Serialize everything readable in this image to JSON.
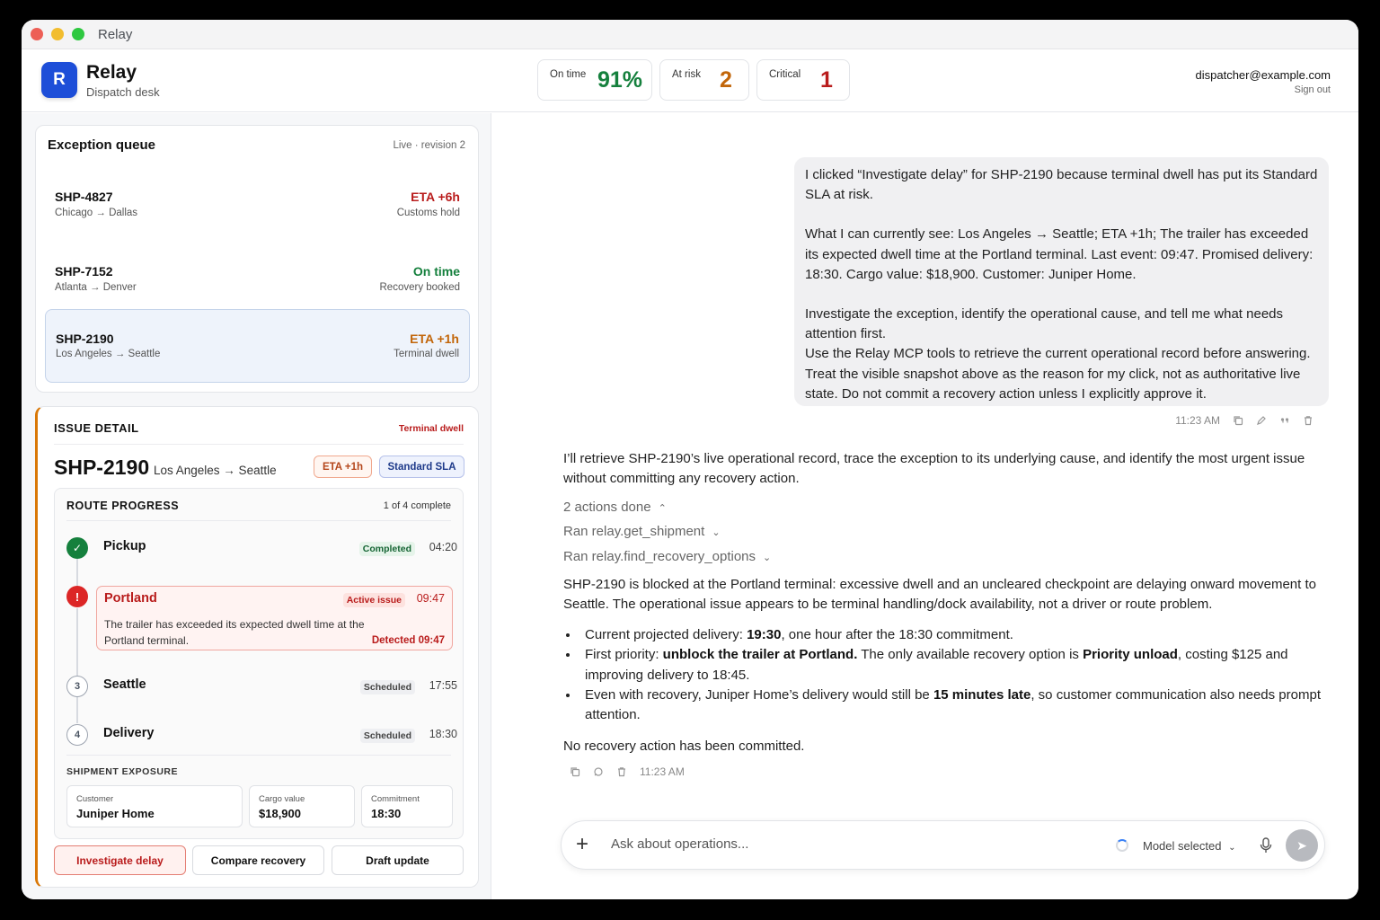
{
  "window": {
    "title": "Relay"
  },
  "header": {
    "logo_letter": "R",
    "app_name": "Relay",
    "app_sub": "Dispatch desk",
    "metrics": [
      {
        "label": "On time",
        "value": "91%",
        "color": "#15803d"
      },
      {
        "label": "At risk",
        "value": "2",
        "color": "#c2660a"
      },
      {
        "label": "Critical",
        "value": "1",
        "color": "#b91c1c"
      }
    ],
    "user_email": "dispatcher@example.com",
    "sign_out": "Sign out"
  },
  "queue": {
    "title": "Exception queue",
    "meta": "Live · revision 2",
    "items": [
      {
        "id": "SHP-4827",
        "route": "Chicago → Dallas",
        "status": "ETA +6h",
        "status_color": "#b91c1c",
        "reason": "Customs hold"
      },
      {
        "id": "SHP-7152",
        "route": "Atlanta → Denver",
        "status": "On time",
        "status_color": "#15803d",
        "reason": "Recovery booked"
      },
      {
        "id": "SHP-2190",
        "route": "Los Angeles → Seattle",
        "status": "ETA +1h",
        "status_color": "#c2660a",
        "reason": "Terminal dwell"
      }
    ]
  },
  "detail": {
    "heading": "ISSUE DETAIL",
    "tag": "Terminal dwell",
    "id": "SHP-2190",
    "route": "Los Angeles → Seattle",
    "eta_pill": "ETA +1h",
    "sla_pill": "Standard SLA",
    "route_progress": {
      "title": "ROUTE PROGRESS",
      "count": "1 of 4 complete",
      "steps": [
        {
          "marker": "✓",
          "name": "Pickup",
          "badge": "Completed",
          "time": "04:20"
        },
        {
          "marker": "!",
          "name": "Portland",
          "badge": "Active issue",
          "time": "09:47",
          "description": "The trailer has exceeded its expected dwell time at the Portland terminal.",
          "detected": "Detected 09:47"
        },
        {
          "marker": "3",
          "name": "Seattle",
          "badge": "Scheduled",
          "time": "17:55"
        },
        {
          "marker": "4",
          "name": "Delivery",
          "badge": "Scheduled",
          "time": "18:30"
        }
      ]
    },
    "exposure": {
      "title": "SHIPMENT EXPOSURE",
      "customer_label": "Customer",
      "customer": "Juniper Home",
      "cargo_label": "Cargo value",
      "cargo": "$18,900",
      "commit_label": "Commitment",
      "commit": "18:30"
    },
    "actions": [
      "Investigate delay",
      "Compare recovery",
      "Draft update"
    ]
  },
  "chat": {
    "user_message": {
      "p1": "I clicked “Investigate delay” for SHP-2190 because terminal dwell has put its Standard SLA at risk.",
      "p2": "What I can currently see: Los Angeles → Seattle; ETA +1h; The trailer has exceeded its expected dwell time at the Portland terminal. Last event: 09:47. Promised delivery: 18:30. Cargo value: $18,900. Customer: Juniper Home.",
      "p3": "Investigate the exception, identify the operational cause, and tell me what needs attention first.",
      "p4": "Use the Relay MCP tools to retrieve the current operational record before answering. Treat the visible snapshot above as the reason for my click, not as authoritative live state. Do not commit a recovery action unless I explicitly approve it.",
      "time": "11:23 AM"
    },
    "assistant": {
      "intro": "I’ll retrieve SHP-2190’s live operational record, trace the exception to its underlying cause, and identify the most urgent issue without committing any recovery action.",
      "actions_done": "2 actions done",
      "tool1": "Ran relay.get_shipment",
      "tool2": "Ran relay.find_recovery_options",
      "summary": "SHP-2190 is blocked at the Portland terminal: excessive dwell and an uncleared checkpoint are delaying onward movement to Seattle. The operational issue appears to be terminal handling/dock availability, not a driver or route problem.",
      "b1a": "Current projected delivery: ",
      "b1b": "19:30",
      "b1c": ", one hour after the 18:30 commitment.",
      "b2a": "First priority: ",
      "b2b": "unblock the trailer at Portland.",
      "b2c": " The only available recovery option is ",
      "b2d": "Priority unload",
      "b2e": ", costing $125 and improving delivery to 18:45.",
      "b3a": "Even with recovery, Juniper Home’s delivery would still be ",
      "b3b": "15 minutes late",
      "b3c": ", so customer communication also needs prompt attention.",
      "closing": "No recovery action has been committed.",
      "time": "11:23 AM"
    },
    "composer": {
      "placeholder": "Ask about operations...",
      "model": "Model selected"
    }
  }
}
